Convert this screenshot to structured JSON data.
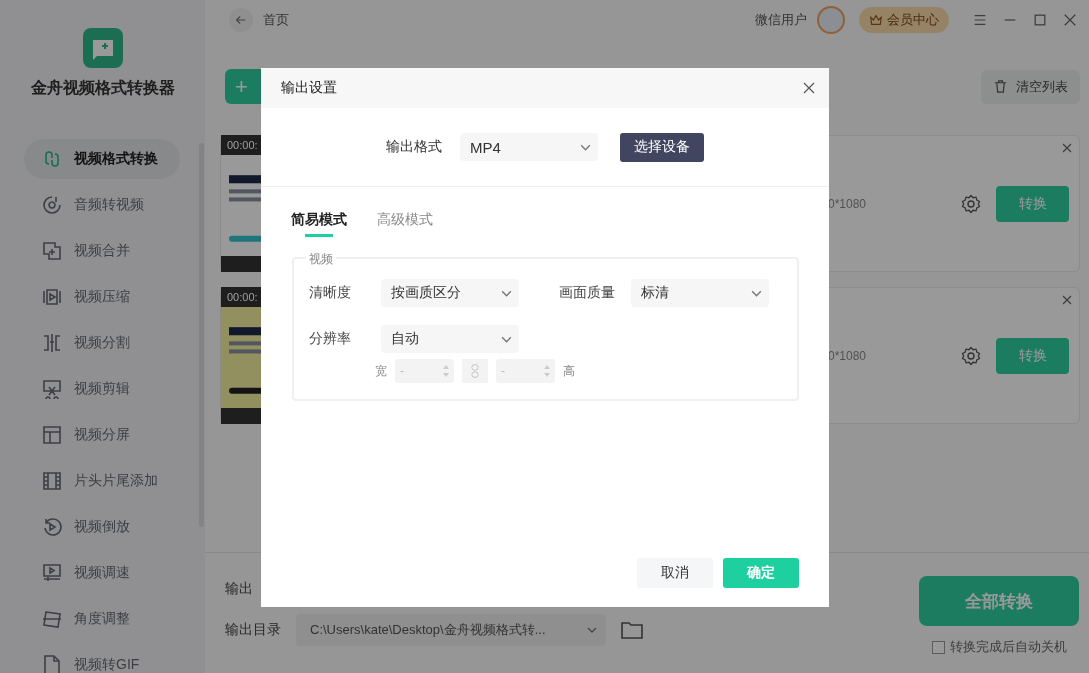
{
  "app": {
    "name": "金舟视频格式转换器"
  },
  "sidebar": {
    "items": [
      {
        "label": "视频格式转换",
        "selected": true
      },
      {
        "label": "音频转视频",
        "selected": false
      },
      {
        "label": "视频合并",
        "selected": false
      },
      {
        "label": "视频压缩",
        "selected": false
      },
      {
        "label": "视频分割",
        "selected": false
      },
      {
        "label": "视频剪辑",
        "selected": false
      },
      {
        "label": "视频分屏",
        "selected": false
      },
      {
        "label": "片头片尾添加",
        "selected": false
      },
      {
        "label": "视频倒放",
        "selected": false
      },
      {
        "label": "视频调速",
        "selected": false
      },
      {
        "label": "角度调整",
        "selected": false
      },
      {
        "label": "视频转GIF",
        "selected": false
      }
    ]
  },
  "header": {
    "back_label": "首页",
    "user": "微信用户",
    "vip_button": "会员中心"
  },
  "toolbar": {
    "add_button": "+",
    "clear_button": "清空列表"
  },
  "files": [
    {
      "time": "00:00:",
      "resolution": "0*1080",
      "convert_button": "转换"
    },
    {
      "time": "00:00:",
      "resolution": "0*1080",
      "convert_button": "转换"
    }
  ],
  "bottom": {
    "output_info_label": "输出",
    "output_dir_label": "输出目录",
    "output_dir": "C:\\Users\\kate\\Desktop\\金舟视频格式转...",
    "convert_all": "全部转换",
    "auto_shutdown": {
      "label": "转换完成后自动关机",
      "checked": false
    }
  },
  "dialog": {
    "title": "输出设置",
    "format_label": "输出格式",
    "format": "MP4",
    "device_button": "选择设备",
    "tabs": [
      {
        "label": "简易模式",
        "selected": true
      },
      {
        "label": "高级模式",
        "selected": false
      }
    ],
    "group": {
      "legend": "视频",
      "clarity": {
        "label": "清晰度",
        "value": "按画质区分"
      },
      "quality": {
        "label": "画面质量",
        "value": "标清"
      },
      "resolution": {
        "label": "分辨率",
        "value": "自动"
      },
      "width_label": "宽",
      "width": {
        "placeholder": "-",
        "disabled": true
      },
      "height": {
        "placeholder": "-",
        "disabled": true
      },
      "height_label": "高"
    },
    "cancel_button": "取消",
    "ok_button": "确定"
  }
}
